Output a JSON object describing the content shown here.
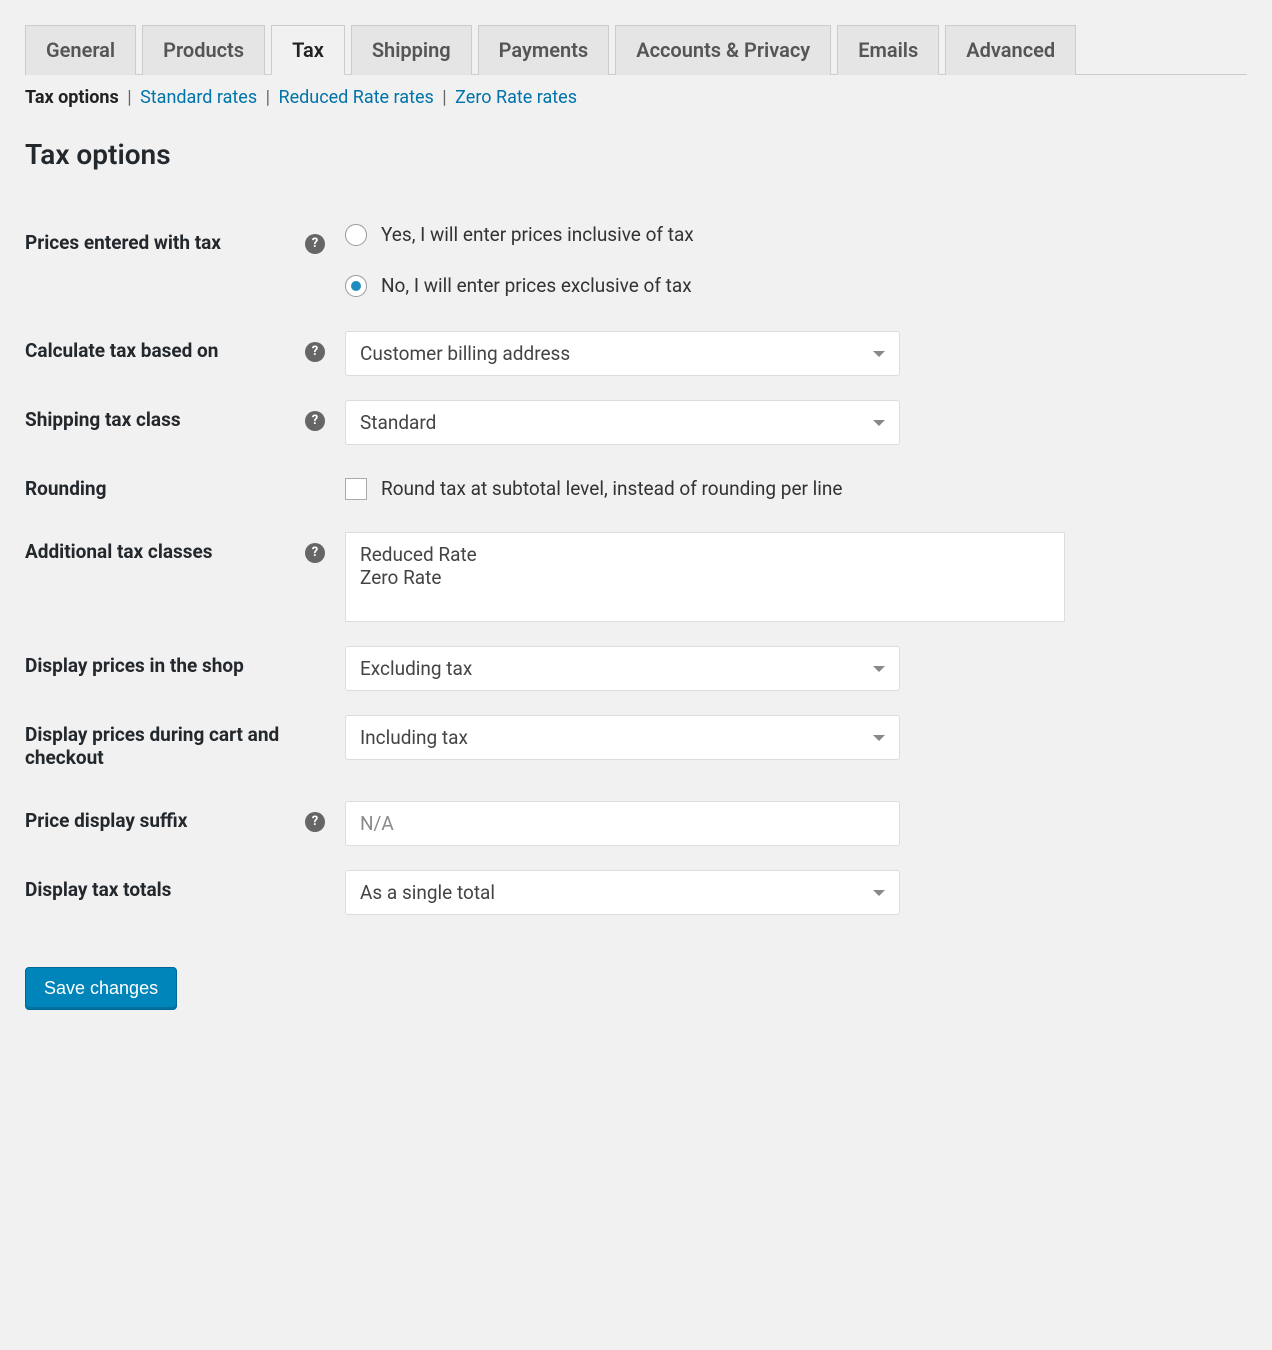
{
  "tabs": {
    "general": "General",
    "products": "Products",
    "tax": "Tax",
    "shipping": "Shipping",
    "payments": "Payments",
    "accounts": "Accounts & Privacy",
    "emails": "Emails",
    "advanced": "Advanced",
    "active": "tax"
  },
  "subsub": {
    "tax_options": "Tax options",
    "standard": "Standard rates",
    "reduced": "Reduced Rate rates",
    "zero": "Zero Rate rates"
  },
  "section_title": "Tax options",
  "fields": {
    "prices_with_tax": {
      "label": "Prices entered with tax",
      "option_yes": "Yes, I will enter prices inclusive of tax",
      "option_no": "No, I will enter prices exclusive of tax",
      "selected": "no"
    },
    "calc_based_on": {
      "label": "Calculate tax based on",
      "value": "Customer billing address"
    },
    "shipping_tax_class": {
      "label": "Shipping tax class",
      "value": "Standard"
    },
    "rounding": {
      "label": "Rounding",
      "option": "Round tax at subtotal level, instead of rounding per line",
      "checked": false
    },
    "additional_classes": {
      "label": "Additional tax classes",
      "value": "Reduced Rate\nZero Rate"
    },
    "display_shop": {
      "label": "Display prices in the shop",
      "value": "Excluding tax"
    },
    "display_cart": {
      "label": "Display prices during cart and checkout",
      "value": "Including tax"
    },
    "price_suffix": {
      "label": "Price display suffix",
      "placeholder": "N/A",
      "value": ""
    },
    "display_totals": {
      "label": "Display tax totals",
      "value": "As a single total"
    }
  },
  "save_button": "Save changes"
}
